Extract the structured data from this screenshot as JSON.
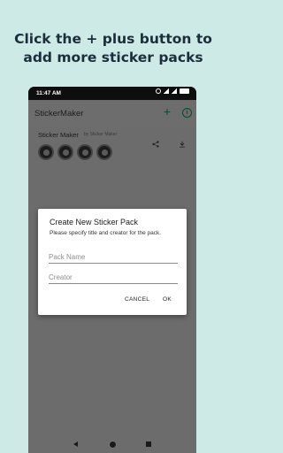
{
  "headline": {
    "line1": "Click the + plus button to",
    "line2": "add more sticker packs"
  },
  "status_bar": {
    "time": "11:47 AM",
    "icons": [
      "alarm-icon",
      "signal-icon",
      "signal-icon",
      "battery-icon"
    ]
  },
  "app_bar": {
    "title": "StickerMaker",
    "add_icon": "+",
    "info_icon": "i",
    "accent_color": "#0d4a2e"
  },
  "pack": {
    "name": "Sticker Maker",
    "creator": "by Sticker Maker",
    "thumbnail_count": 4
  },
  "dialog": {
    "title": "Create New Sticker Pack",
    "message": "Please specify title and creator for the pack.",
    "pack_name_placeholder": "Pack Name",
    "creator_placeholder": "Creator",
    "cancel_label": "CANCEL",
    "ok_label": "OK"
  },
  "colors": {
    "page_background": "#cdeae6",
    "headline_text": "#1c2e3c",
    "scrim": "#6c6c6c"
  }
}
